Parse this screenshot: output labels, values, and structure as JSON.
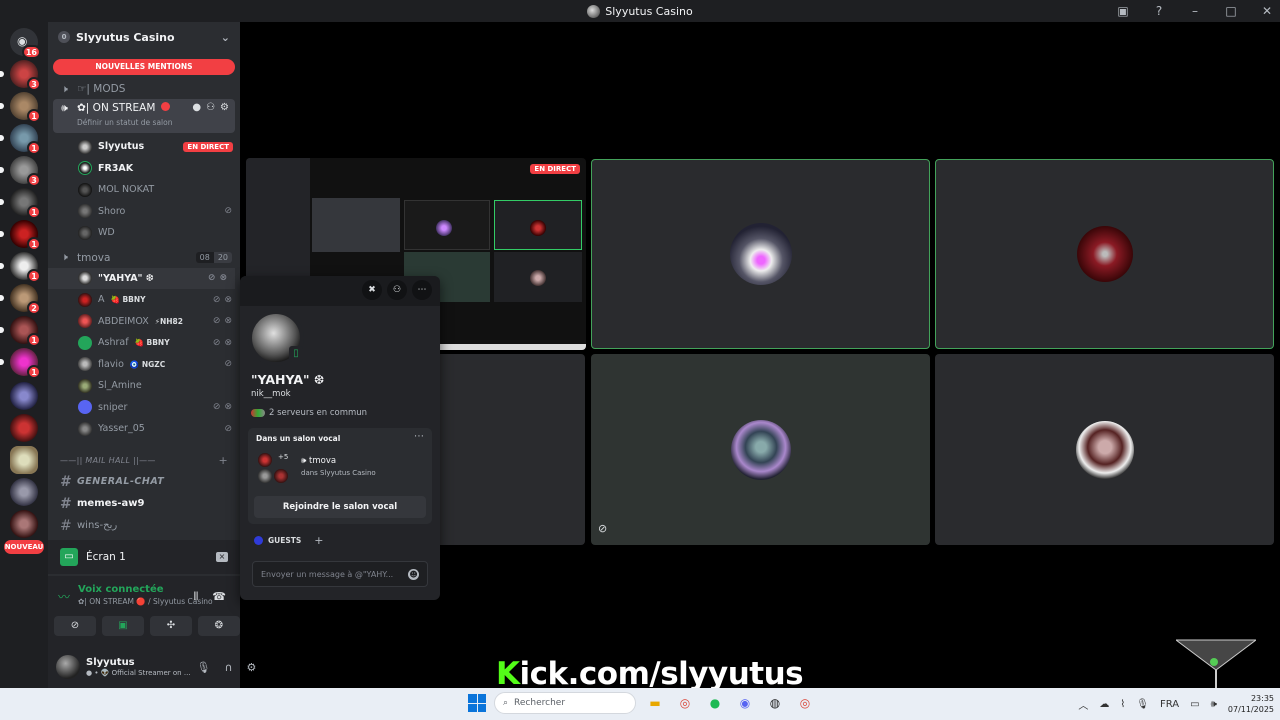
{
  "window": {
    "title": "Slyyutus Casino"
  },
  "server": {
    "name": "Slyyutus Casino",
    "boost_level": "0",
    "rail_badges": [
      "16",
      "3",
      "1",
      "1",
      "3",
      "1",
      "1",
      "1",
      "2",
      "1",
      "1"
    ],
    "nouveau_label": "NOUVEAU"
  },
  "sidebar": {
    "mentions_pill": "NOUVELLES MENTIONS",
    "mods_channel": "☞| MODS",
    "on_stream": {
      "name": "✿| ON STREAM",
      "status_hint": "Définir un statut de salon"
    },
    "on_stream_members": [
      {
        "name": "Slyyutus",
        "badge": "EN DIRECT"
      },
      {
        "name": "FR3AK"
      },
      {
        "name": "MOL NOKAT"
      },
      {
        "name": "Shoro"
      },
      {
        "name": "WD"
      }
    ],
    "tmova": {
      "name": "tmova",
      "count": "08",
      "limit": "20"
    },
    "tmova_members": [
      {
        "name": "\"YAHYA\" ❆",
        "tag": ""
      },
      {
        "name": "A",
        "tag": "🍓 BBNY"
      },
      {
        "name": "ABDEIMOX",
        "tag": "⚡NH82"
      },
      {
        "name": "Ashraf",
        "tag": "🍓 BBNY"
      },
      {
        "name": "flavio",
        "tag": "🧿 NGZC"
      },
      {
        "name": "Sl_Amine",
        "tag": ""
      },
      {
        "name": "sniper",
        "tag": ""
      },
      {
        "name": "Yasser_05",
        "tag": ""
      }
    ],
    "category": "——|| MAIL HALL ||——",
    "text_channels": [
      "GENERAL-CHAT",
      "memes-aw9",
      "wins-ربح"
    ]
  },
  "screen_share": {
    "label": "Écran 1"
  },
  "voice": {
    "title": "Voix connectée",
    "subtitle": "✿| ON STREAM 🔴 / Slyyutus Casino"
  },
  "user": {
    "name": "Slyyutus",
    "status": "● • 👽 Official Streamer on ..."
  },
  "stream": {
    "live_label": "EN DIRECT"
  },
  "popout": {
    "display_name": "\"YAHYA\" ❆",
    "username": "nik__mok",
    "mutual": "2 serveurs en commun",
    "voice_header": "Dans un salon vocal",
    "extra_count": "+5",
    "channel": "🕪 tmova",
    "server_line": "dans Slyyutus Casino",
    "join_label": "Rejoindre le salon vocal",
    "role": "GUESTS",
    "message_placeholder": "Envoyer un message à @\"YAHY..."
  },
  "overlay": {
    "kick_prefix": "K",
    "kick_rest": "ick.com/slyyutus"
  },
  "taskbar": {
    "search_placeholder": "Rechercher",
    "lang": "FRA",
    "time": "23:35",
    "date": "07/11/2025"
  },
  "colors": {
    "live_red": "#f23f43",
    "voice_green": "#23a55a",
    "kick_green": "#53fc18",
    "speaking_border": "#43a25a"
  }
}
